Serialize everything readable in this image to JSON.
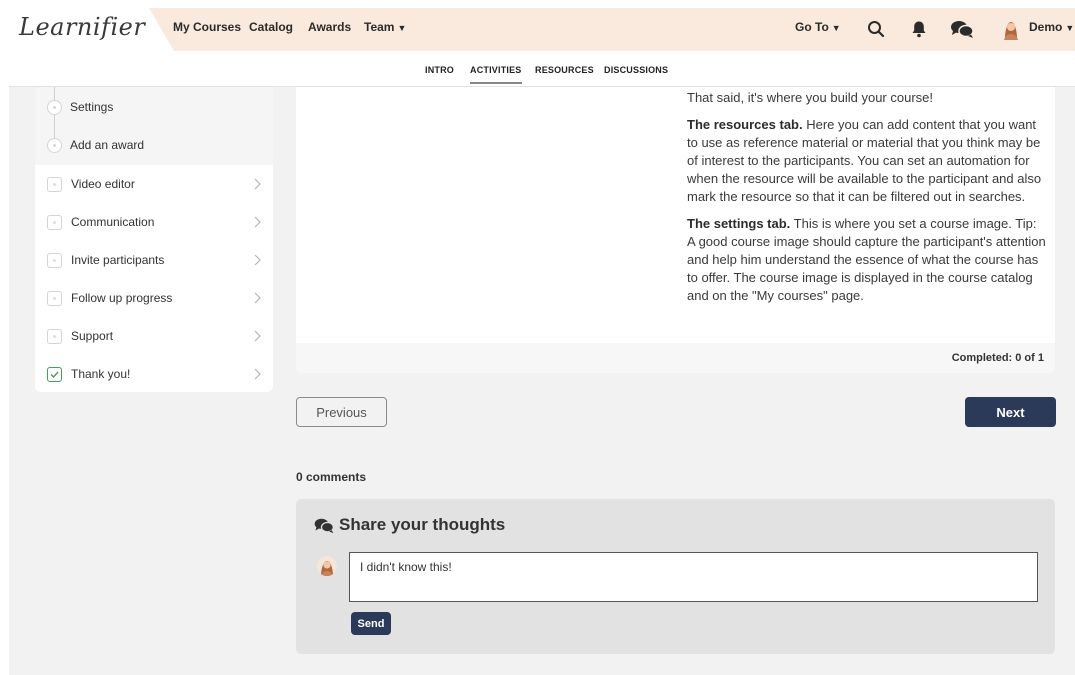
{
  "brand": {
    "logo_text": "Learnifier"
  },
  "nav": {
    "my_courses": "My Courses",
    "catalog": "Catalog",
    "awards": "Awards",
    "team": "Team",
    "goto": "Go To",
    "user_name": "Demo",
    "icons": [
      "search-icon",
      "bell-icon",
      "chat-icon",
      "avatar"
    ]
  },
  "subnav": {
    "tabs": [
      {
        "label": "INTRO"
      },
      {
        "label": "ACTIVITIES",
        "active": true
      },
      {
        "label": "RESOURCES"
      },
      {
        "label": "DISCUSSIONS"
      }
    ]
  },
  "sidebar": {
    "substeps": [
      {
        "label": "Settings"
      },
      {
        "label": "Add an award"
      }
    ],
    "steps": [
      {
        "label": "Video editor",
        "done": false
      },
      {
        "label": "Communication",
        "done": false
      },
      {
        "label": "Invite participants",
        "done": false
      },
      {
        "label": "Follow up progress",
        "done": false
      },
      {
        "label": "Support",
        "done": false
      },
      {
        "label": "Thank you!",
        "done": true
      }
    ]
  },
  "content": {
    "p1": "That said, it's where you build your course!",
    "p2_bold": "The resources tab.",
    "p2": " Here you can add content that you want to use as reference material or material that you think may be of interest to the participants. You can set an automation for when the resource will be available to the participant and also mark the resource so that it can be filtered out in searches.",
    "p3_bold": "The settings tab.",
    "p3": " This is where you set a course image. Tip: A good course image should capture the participant's attention and help him understand the essence of what the course has to offer. The course image is displayed in the course catalog and on the \"My courses\" page.",
    "completed": "Completed: 0 of 1"
  },
  "buttons": {
    "previous": "Previous",
    "next": "Next"
  },
  "comments": {
    "count_label": "0 comments",
    "share_title": "Share your thoughts",
    "input_value": "I didn't know this!",
    "send_label": "Send"
  },
  "colors": {
    "nav_bg": "#f9eadd",
    "primary_button": "#2b3a58",
    "page_bg": "#f2f2f2",
    "check_green": "#4a9a5a"
  }
}
